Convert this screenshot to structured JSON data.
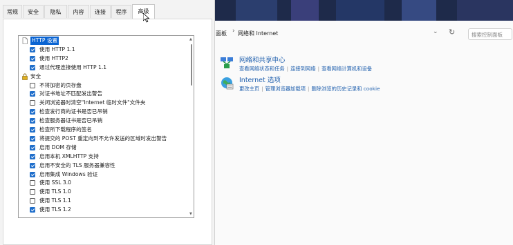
{
  "dialog": {
    "tabs": [
      {
        "label": "常规",
        "active": false
      },
      {
        "label": "安全",
        "active": false
      },
      {
        "label": "隐私",
        "active": false
      },
      {
        "label": "内容",
        "active": false
      },
      {
        "label": "连接",
        "active": false
      },
      {
        "label": "程序",
        "active": false
      },
      {
        "label": "高级",
        "active": true
      }
    ],
    "settings": [
      {
        "type": "category",
        "label": "HTTP 设置",
        "icon": "page-icon",
        "selected": true
      },
      {
        "type": "option",
        "label": "使用 HTTP 1.1",
        "checked": true
      },
      {
        "type": "option",
        "label": "使用 HTTP2",
        "checked": true
      },
      {
        "type": "option",
        "label": "通过代理连接使用 HTTP 1.1",
        "checked": true
      },
      {
        "type": "category",
        "label": "安全",
        "icon": "lock-icon",
        "selected": false
      },
      {
        "type": "option",
        "label": "不将加密的页存盘",
        "checked": false
      },
      {
        "type": "option",
        "label": "对证书地址不匹配发出警告",
        "checked": true
      },
      {
        "type": "option",
        "label": "关闭浏览器时清空\"Internet 临时文件\"文件夹",
        "checked": false
      },
      {
        "type": "option",
        "label": "检查发行商的证书是否已吊销",
        "checked": true
      },
      {
        "type": "option",
        "label": "检查服务器证书是否已吊销",
        "checked": true
      },
      {
        "type": "option",
        "label": "检查所下载程序的签名",
        "checked": true
      },
      {
        "type": "option",
        "label": "将提交的 POST 重定向到不允许发送的区域时发出警告",
        "checked": true
      },
      {
        "type": "option",
        "label": "启用 DOM 存储",
        "checked": true
      },
      {
        "type": "option",
        "label": "启用本机 XMLHTTP 支持",
        "checked": true
      },
      {
        "type": "option",
        "label": "启用不安全的 TLS 服务器兼容性",
        "checked": true
      },
      {
        "type": "option",
        "label": "启用集成 Windows 验证",
        "checked": true
      },
      {
        "type": "option",
        "label": "使用 SSL 3.0",
        "checked": false
      },
      {
        "type": "option",
        "label": "使用 TLS 1.0",
        "checked": false
      },
      {
        "type": "option",
        "label": "使用 TLS 1.1",
        "checked": false
      },
      {
        "type": "option",
        "label": "使用 TLS 1.2",
        "checked": true
      }
    ]
  },
  "address_bar": {
    "crumbs": [
      "面板",
      "网络和 Internet"
    ],
    "separator": "›",
    "search_placeholder": "搜索控制面板"
  },
  "control_panel": {
    "items": [
      {
        "title": "网络和共享中心",
        "icon": "network-center-icon",
        "links": [
          "查看网络状态和任务",
          "连接到网络",
          "查看网络计算机和设备"
        ]
      },
      {
        "title": "Internet 选项",
        "icon": "internet-options-icon",
        "links": [
          "更改主页",
          "管理浏览器加载项",
          "删除浏览的历史记录和 cookie"
        ]
      }
    ]
  },
  "colors": {
    "accent": "#1f6ecb",
    "link": "#1f5fad",
    "selection": "#0a64d2"
  }
}
